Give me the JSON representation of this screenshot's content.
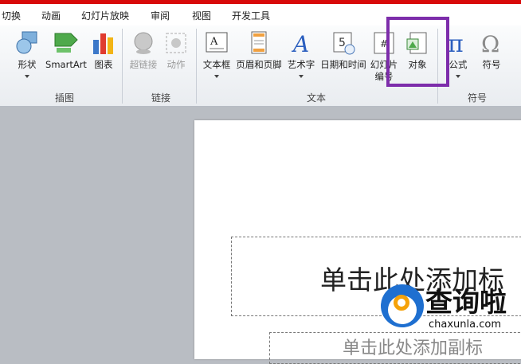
{
  "tabs": [
    "切换",
    "动画",
    "幻灯片放映",
    "审阅",
    "视图",
    "开发工具"
  ],
  "groups": {
    "illustrations": "插图",
    "links": "链接",
    "text": "文本",
    "symbols": "符号"
  },
  "buttons": {
    "shapes": "形状",
    "smartart": "SmartArt",
    "chart": "图表",
    "hyperlink": "超链接",
    "action": "动作",
    "textbox": "文本框",
    "header_footer": "页眉和页脚",
    "wordart": "艺术字",
    "datetime": "日期和时间",
    "slide_number_1": "幻灯片",
    "slide_number_2": "编号",
    "object": "对象",
    "equation": "公式",
    "symbol": "符号"
  },
  "slide": {
    "title_placeholder": "单击此处添加标",
    "subtitle_placeholder": "单击此处添加副标"
  },
  "watermark": {
    "text": "查询啦",
    "url": "chaxunla.com"
  },
  "colors": {
    "accent_bar": "#d80a0a",
    "highlight": "#7d2dab"
  }
}
